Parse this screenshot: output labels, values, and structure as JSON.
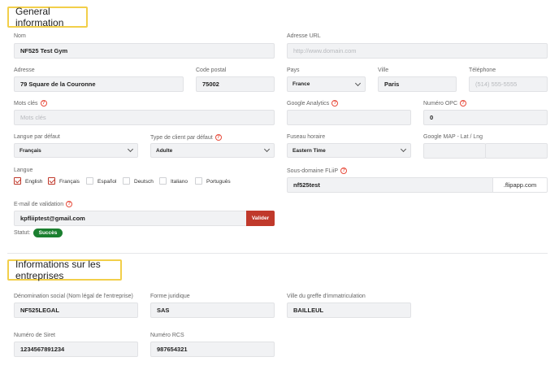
{
  "general": {
    "title": "General information",
    "nom_label": "Nom",
    "nom_value": "NF525 Test Gym",
    "url_label": "Adresse URL",
    "url_placeholder": "http://www.domain.com",
    "adresse_label": "Adresse",
    "adresse_value": "79 Square de la Couronne",
    "cp_label": "Code postal",
    "cp_value": "75002",
    "pays_label": "Pays",
    "pays_value": "France",
    "ville_label": "Ville",
    "ville_value": "Paris",
    "tel_label": "Téléphone",
    "tel_placeholder": "(514) 555-5555",
    "mots_label": "Mots clés",
    "mots_placeholder": "Mots clés",
    "ga_label": "Google Analytics",
    "ga_value": "",
    "opc_label": "Numéro OPC",
    "opc_value": "0",
    "langue_defaut_label": "Langue par défaut",
    "langue_defaut_value": "Français",
    "type_client_label": "Type de client par défaut",
    "type_client_value": "Adulte",
    "fuseau_label": "Fuseau horaire",
    "fuseau_value": "Eastern Time",
    "map_label": "Google MAP - Lat / Lng",
    "map_lat": "",
    "map_lng": "",
    "langue_label": "Langue",
    "langues": [
      {
        "label": "English",
        "checked": true
      },
      {
        "label": "Français",
        "checked": true
      },
      {
        "label": "Español",
        "checked": false
      },
      {
        "label": "Deutsch",
        "checked": false
      },
      {
        "label": "Italiano",
        "checked": false
      },
      {
        "label": "Português",
        "checked": false
      }
    ],
    "sousdomaine_label": "Sous-domaine FLiiP",
    "sousdomaine_value": "nf525test",
    "sousdomaine_suffix": ".flipapp.com",
    "email_label": "E-mail de validation",
    "email_value": "kpfliiptest@gmail.com",
    "valider_label": "Valider",
    "statut_label": "Statut:",
    "statut_value": "Succès"
  },
  "entreprise": {
    "title": "Informations sur les entreprises",
    "denom_label": "Dénomination social (Nom légal de l'entreprise)",
    "denom_value": "NF525LEGAL",
    "forme_label": "Forme juridique",
    "forme_value": "SAS",
    "greffe_label": "Ville du greffe d'immatriculation",
    "greffe_value": "BAILLEUL",
    "siret_label": "Numéro de Siret",
    "siret_value": "1234567891234",
    "rcs_label": "Numéro RCS",
    "rcs_value": "987654321"
  },
  "colors": {
    "accent": "#c0392b",
    "highlight_border": "#f2cf4a",
    "success": "#1a7f2f"
  }
}
